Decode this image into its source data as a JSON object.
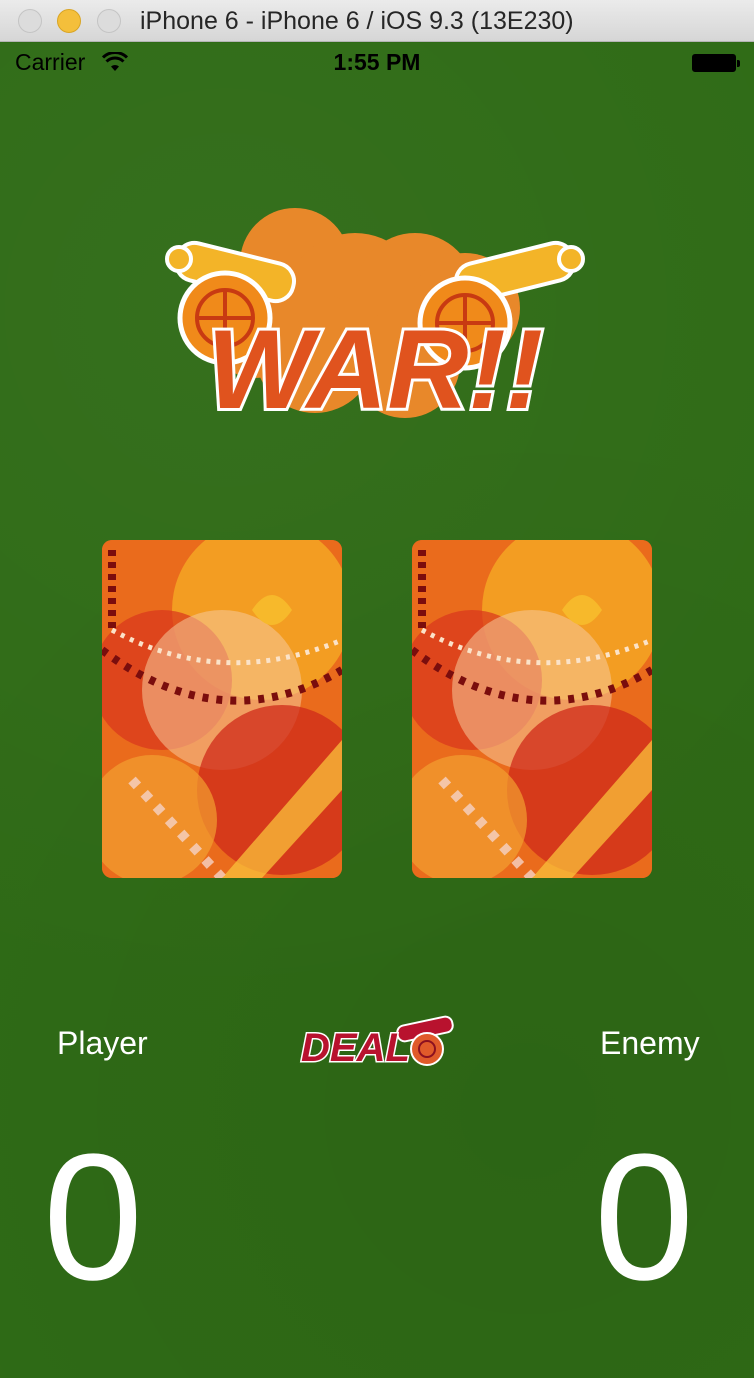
{
  "window": {
    "title": "iPhone 6 - iPhone 6 / iOS 9.3 (13E230)"
  },
  "statusbar": {
    "carrier": "Carrier",
    "time": "1:55 PM",
    "wifi_icon": "wifi-icon",
    "battery_icon": "battery-icon"
  },
  "game": {
    "logo_text": "WAR!!",
    "player_card": "card-back",
    "enemy_card": "card-back",
    "player_label": "Player",
    "enemy_label": "Enemy",
    "deal_label": "DEAL",
    "player_score": "0",
    "enemy_score": "0"
  },
  "colors": {
    "felt": "#2f6b16",
    "logo_orange": "#e8882a",
    "logo_text": "#d64a1a",
    "deal_red": "#b8122e"
  }
}
